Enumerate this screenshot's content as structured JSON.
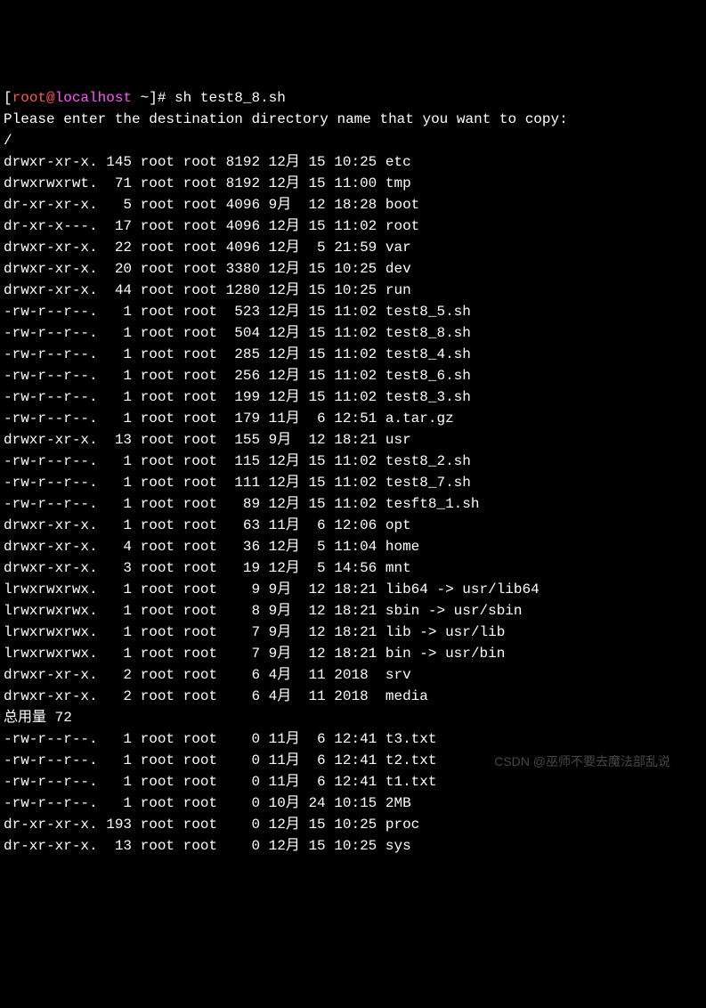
{
  "prompt": {
    "open_bracket": "[",
    "user_at": "root@",
    "hostname": "localhost",
    "path": " ~",
    "close_bracket": "]# ",
    "command": "sh test8_8.sh"
  },
  "script_output": {
    "prompt_text": "Please enter the destination directory name that you want to copy:",
    "input": "/"
  },
  "listing": [
    {
      "perms": "drwxr-xr-x.",
      "links": "145",
      "owner": "root",
      "group": "root",
      "size": "8192",
      "month": "12月",
      "day": "15",
      "time": "10:25",
      "name": "etc"
    },
    {
      "perms": "drwxrwxrwt.",
      "links": " 71",
      "owner": "root",
      "group": "root",
      "size": "8192",
      "month": "12月",
      "day": "15",
      "time": "11:00",
      "name": "tmp"
    },
    {
      "perms": "dr-xr-xr-x.",
      "links": "  5",
      "owner": "root",
      "group": "root",
      "size": "4096",
      "month": "9月 ",
      "day": "12",
      "time": "18:28",
      "name": "boot"
    },
    {
      "perms": "dr-xr-x---.",
      "links": " 17",
      "owner": "root",
      "group": "root",
      "size": "4096",
      "month": "12月",
      "day": "15",
      "time": "11:02",
      "name": "root"
    },
    {
      "perms": "drwxr-xr-x.",
      "links": " 22",
      "owner": "root",
      "group": "root",
      "size": "4096",
      "month": "12月",
      "day": " 5",
      "time": "21:59",
      "name": "var"
    },
    {
      "perms": "drwxr-xr-x.",
      "links": " 20",
      "owner": "root",
      "group": "root",
      "size": "3380",
      "month": "12月",
      "day": "15",
      "time": "10:25",
      "name": "dev"
    },
    {
      "perms": "drwxr-xr-x.",
      "links": " 44",
      "owner": "root",
      "group": "root",
      "size": "1280",
      "month": "12月",
      "day": "15",
      "time": "10:25",
      "name": "run"
    },
    {
      "perms": "-rw-r--r--.",
      "links": "  1",
      "owner": "root",
      "group": "root",
      "size": " 523",
      "month": "12月",
      "day": "15",
      "time": "11:02",
      "name": "test8_5.sh"
    },
    {
      "perms": "-rw-r--r--.",
      "links": "  1",
      "owner": "root",
      "group": "root",
      "size": " 504",
      "month": "12月",
      "day": "15",
      "time": "11:02",
      "name": "test8_8.sh"
    },
    {
      "perms": "-rw-r--r--.",
      "links": "  1",
      "owner": "root",
      "group": "root",
      "size": " 285",
      "month": "12月",
      "day": "15",
      "time": "11:02",
      "name": "test8_4.sh"
    },
    {
      "perms": "-rw-r--r--.",
      "links": "  1",
      "owner": "root",
      "group": "root",
      "size": " 256",
      "month": "12月",
      "day": "15",
      "time": "11:02",
      "name": "test8_6.sh"
    },
    {
      "perms": "-rw-r--r--.",
      "links": "  1",
      "owner": "root",
      "group": "root",
      "size": " 199",
      "month": "12月",
      "day": "15",
      "time": "11:02",
      "name": "test8_3.sh"
    },
    {
      "perms": "-rw-r--r--.",
      "links": "  1",
      "owner": "root",
      "group": "root",
      "size": " 179",
      "month": "11月",
      "day": " 6",
      "time": "12:51",
      "name": "a.tar.gz"
    },
    {
      "perms": "drwxr-xr-x.",
      "links": " 13",
      "owner": "root",
      "group": "root",
      "size": " 155",
      "month": "9月 ",
      "day": "12",
      "time": "18:21",
      "name": "usr"
    },
    {
      "perms": "-rw-r--r--.",
      "links": "  1",
      "owner": "root",
      "group": "root",
      "size": " 115",
      "month": "12月",
      "day": "15",
      "time": "11:02",
      "name": "test8_2.sh"
    },
    {
      "perms": "-rw-r--r--.",
      "links": "  1",
      "owner": "root",
      "group": "root",
      "size": " 111",
      "month": "12月",
      "day": "15",
      "time": "11:02",
      "name": "test8_7.sh"
    },
    {
      "perms": "-rw-r--r--.",
      "links": "  1",
      "owner": "root",
      "group": "root",
      "size": "  89",
      "month": "12月",
      "day": "15",
      "time": "11:02",
      "name": "tesft8_1.sh"
    },
    {
      "perms": "drwxr-xr-x.",
      "links": "  1",
      "owner": "root",
      "group": "root",
      "size": "  63",
      "month": "11月",
      "day": " 6",
      "time": "12:06",
      "name": "opt"
    },
    {
      "perms": "drwxr-xr-x.",
      "links": "  4",
      "owner": "root",
      "group": "root",
      "size": "  36",
      "month": "12月",
      "day": " 5",
      "time": "11:04",
      "name": "home"
    },
    {
      "perms": "drwxr-xr-x.",
      "links": "  3",
      "owner": "root",
      "group": "root",
      "size": "  19",
      "month": "12月",
      "day": " 5",
      "time": "14:56",
      "name": "mnt"
    },
    {
      "perms": "lrwxrwxrwx.",
      "links": "  1",
      "owner": "root",
      "group": "root",
      "size": "   9",
      "month": "9月 ",
      "day": "12",
      "time": "18:21",
      "name": "lib64 -> usr/lib64"
    },
    {
      "perms": "lrwxrwxrwx.",
      "links": "  1",
      "owner": "root",
      "group": "root",
      "size": "   8",
      "month": "9月 ",
      "day": "12",
      "time": "18:21",
      "name": "sbin -> usr/sbin"
    },
    {
      "perms": "lrwxrwxrwx.",
      "links": "  1",
      "owner": "root",
      "group": "root",
      "size": "   7",
      "month": "9月 ",
      "day": "12",
      "time": "18:21",
      "name": "lib -> usr/lib"
    },
    {
      "perms": "lrwxrwxrwx.",
      "links": "  1",
      "owner": "root",
      "group": "root",
      "size": "   7",
      "month": "9月 ",
      "day": "12",
      "time": "18:21",
      "name": "bin -> usr/bin"
    },
    {
      "perms": "drwxr-xr-x.",
      "links": "  2",
      "owner": "root",
      "group": "root",
      "size": "   6",
      "month": "4月 ",
      "day": "11",
      "time": "2018 ",
      "name": "srv"
    },
    {
      "perms": "drwxr-xr-x.",
      "links": "  2",
      "owner": "root",
      "group": "root",
      "size": "   6",
      "month": "4月 ",
      "day": "11",
      "time": "2018 ",
      "name": "media"
    }
  ],
  "total_line": "总用量 72",
  "listing2": [
    {
      "perms": "-rw-r--r--.",
      "links": "  1",
      "owner": "root",
      "group": "root",
      "size": "   0",
      "month": "11月",
      "day": " 6",
      "time": "12:41",
      "name": "t3.txt"
    },
    {
      "perms": "-rw-r--r--.",
      "links": "  1",
      "owner": "root",
      "group": "root",
      "size": "   0",
      "month": "11月",
      "day": " 6",
      "time": "12:41",
      "name": "t2.txt"
    },
    {
      "perms": "-rw-r--r--.",
      "links": "  1",
      "owner": "root",
      "group": "root",
      "size": "   0",
      "month": "11月",
      "day": " 6",
      "time": "12:41",
      "name": "t1.txt"
    },
    {
      "perms": "-rw-r--r--.",
      "links": "  1",
      "owner": "root",
      "group": "root",
      "size": "   0",
      "month": "10月",
      "day": "24",
      "time": "10:15",
      "name": "2MB"
    },
    {
      "perms": "dr-xr-xr-x.",
      "links": "193",
      "owner": "root",
      "group": "root",
      "size": "   0",
      "month": "12月",
      "day": "15",
      "time": "10:25",
      "name": "proc"
    },
    {
      "perms": "dr-xr-xr-x.",
      "links": " 13",
      "owner": "root",
      "group": "root",
      "size": "   0",
      "month": "12月",
      "day": "15",
      "time": "10:25",
      "name": "sys"
    }
  ],
  "watermark": "CSDN @巫师不要去魔法部乱说"
}
